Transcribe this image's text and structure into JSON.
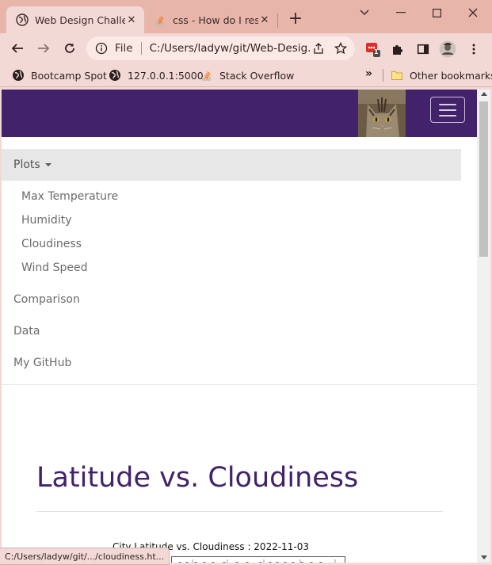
{
  "browser": {
    "tabs": [
      {
        "title": "Web Design Challen",
        "favicon": "globe-icon",
        "active": true
      },
      {
        "title": "css - How do I resiz",
        "favicon": "stackoverflow-icon",
        "active": false
      }
    ],
    "address": {
      "scheme": "File",
      "url": "C:/Users/ladyw/git/Web-Desig..."
    },
    "bookmarks": [
      {
        "label": "Bootcamp Spot",
        "icon": "globe-icon"
      },
      {
        "label": "127.0.0.1:5000",
        "icon": "globe-icon"
      },
      {
        "label": "Stack Overflow",
        "icon": "stackoverflow-icon"
      }
    ],
    "other_bookmarks": "Other bookmarks",
    "extension_badge": "1",
    "status_url": "C:/Users/ladyw/git/.../cloudiness.ht..."
  },
  "page": {
    "nav": {
      "dropdown_label": "Plots",
      "plots_items": [
        "Max Temperature",
        "Humidity",
        "Cloudiness",
        "Wind Speed"
      ],
      "links": [
        "Comparison",
        "Data",
        "My GitHub"
      ]
    },
    "heading": "Latitude vs. Cloudiness",
    "chart_title": "City Latitude vs. Cloudiness : 2022-11-03"
  },
  "colors": {
    "tab_strip": "#e8b5ab",
    "toolbar": "#f3d9d6",
    "nav_purple": "#42226b",
    "menu_highlight": "#e7e7e7"
  }
}
